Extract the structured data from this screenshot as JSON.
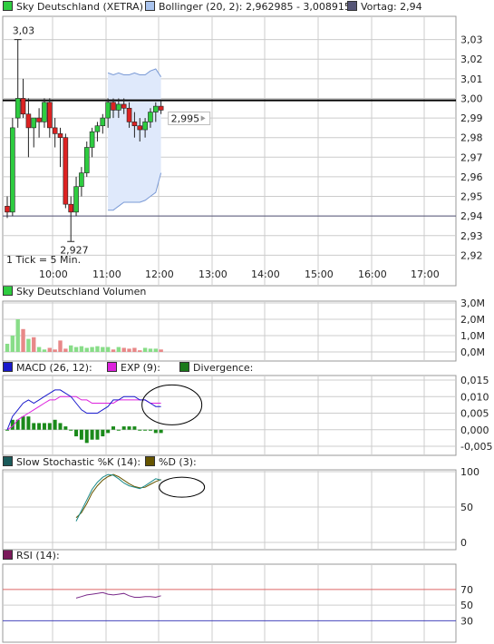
{
  "price_panel": {
    "legend": [
      {
        "label": "Sky Deutschland (XETRA)",
        "color": "#2ecc40"
      },
      {
        "label": "Bollinger (20, 2): 2,962985 - 3,008915",
        "color": "#aac4ee"
      },
      {
        "label": "Vortag: 2,94",
        "color": "#555577"
      }
    ],
    "high_label": "3,03",
    "low_label": "2,927",
    "last_label": "2,995",
    "tick_note": "1 Tick = 5 Min."
  },
  "volume_panel": {
    "legend": [
      {
        "label": "Sky Deutschland Volumen",
        "color": "#2ecc40"
      }
    ]
  },
  "macd_panel": {
    "legend": [
      {
        "label": "MACD (26, 12):",
        "color": "#1a1acc"
      },
      {
        "label": "EXP (9):",
        "color": "#dd22dd"
      },
      {
        "label": "Divergence:",
        "color": "#1a7a1a"
      }
    ]
  },
  "stoch_panel": {
    "legend": [
      {
        "label": "Slow Stochastic %K (14):",
        "color": "#1a5a5a"
      },
      {
        "label": "%D (3):",
        "color": "#665500"
      }
    ]
  },
  "rsi_panel": {
    "legend": [
      {
        "label": "RSI (14):",
        "color": "#7a1a5a"
      }
    ]
  },
  "chart_data": [
    {
      "type": "candlestick",
      "title": "Sky Deutschland (XETRA)",
      "x_ticks": [
        "10:00",
        "11:00",
        "12:00",
        "13:00",
        "14:00",
        "15:00",
        "16:00",
        "17:00"
      ],
      "y_ticks": [
        "3,03",
        "3,02",
        "3,01",
        "3,00",
        "2,99",
        "2,98",
        "2,97",
        "2,96",
        "2,95",
        "2,94",
        "2,93",
        "2,92"
      ],
      "ylim": [
        2.91,
        3.04
      ],
      "session_start": "09:00",
      "interval_minutes": 5,
      "previous_close": 2.94,
      "reference_line": 2.999,
      "candles": [
        {
          "o": 2.945,
          "h": 2.95,
          "l": 2.939,
          "c": 2.942
        },
        {
          "o": 2.942,
          "h": 2.99,
          "l": 2.94,
          "c": 2.985
        },
        {
          "o": 2.99,
          "h": 3.03,
          "l": 2.985,
          "c": 3.0
        },
        {
          "o": 3.0,
          "h": 3.01,
          "l": 2.99,
          "c": 2.992
        },
        {
          "o": 2.992,
          "h": 3.0,
          "l": 2.97,
          "c": 2.985
        },
        {
          "o": 2.985,
          "h": 2.99,
          "l": 2.975,
          "c": 2.99
        },
        {
          "o": 2.99,
          "h": 2.995,
          "l": 2.98,
          "c": 2.988
        },
        {
          "o": 2.988,
          "h": 3.0,
          "l": 2.985,
          "c": 2.998
        },
        {
          "o": 2.998,
          "h": 3.0,
          "l": 2.98,
          "c": 2.985
        },
        {
          "o": 2.985,
          "h": 2.99,
          "l": 2.975,
          "c": 2.982
        },
        {
          "o": 2.982,
          "h": 2.985,
          "l": 2.965,
          "c": 2.98
        },
        {
          "o": 2.98,
          "h": 2.982,
          "l": 2.944,
          "c": 2.946
        },
        {
          "o": 2.946,
          "h": 2.95,
          "l": 2.927,
          "c": 2.942
        },
        {
          "o": 2.942,
          "h": 2.96,
          "l": 2.94,
          "c": 2.955
        },
        {
          "o": 2.955,
          "h": 2.965,
          "l": 2.95,
          "c": 2.962
        },
        {
          "o": 2.962,
          "h": 2.978,
          "l": 2.96,
          "c": 2.975
        },
        {
          "o": 2.975,
          "h": 2.985,
          "l": 2.97,
          "c": 2.983
        },
        {
          "o": 2.983,
          "h": 2.988,
          "l": 2.978,
          "c": 2.986
        },
        {
          "o": 2.986,
          "h": 2.992,
          "l": 2.982,
          "c": 2.99
        },
        {
          "o": 2.99,
          "h": 3.0,
          "l": 2.985,
          "c": 2.998
        },
        {
          "o": 2.998,
          "h": 3.0,
          "l": 2.99,
          "c": 2.994
        },
        {
          "o": 2.994,
          "h": 3.0,
          "l": 2.99,
          "c": 2.997
        },
        {
          "o": 2.997,
          "h": 3.0,
          "l": 2.992,
          "c": 2.995
        },
        {
          "o": 2.995,
          "h": 2.998,
          "l": 2.985,
          "c": 2.988
        },
        {
          "o": 2.988,
          "h": 2.993,
          "l": 2.98,
          "c": 2.986
        },
        {
          "o": 2.986,
          "h": 2.99,
          "l": 2.978,
          "c": 2.984
        },
        {
          "o": 2.984,
          "h": 2.99,
          "l": 2.98,
          "c": 2.988
        },
        {
          "o": 2.988,
          "h": 2.995,
          "l": 2.985,
          "c": 2.993
        },
        {
          "o": 2.993,
          "h": 2.998,
          "l": 2.988,
          "c": 2.996
        },
        {
          "o": 2.996,
          "h": 2.999,
          "l": 2.992,
          "c": 2.994
        }
      ],
      "bollinger_start_index": 19,
      "bollinger_upper": [
        3.013,
        3.012,
        3.013,
        3.012,
        3.012,
        3.013,
        3.012,
        3.012,
        3.014,
        3.015,
        3.011
      ],
      "bollinger_lower": [
        2.943,
        2.943,
        2.945,
        2.947,
        2.947,
        2.947,
        2.947,
        2.948,
        2.95,
        2.952,
        2.962
      ]
    },
    {
      "type": "bar",
      "title": "Sky Deutschland Volumen",
      "y_ticks": [
        "3,0M",
        "2,0M",
        "1,0M",
        "0,0M"
      ],
      "ylim": [
        0,
        3000000
      ],
      "values": [
        500000,
        1000000,
        2000000,
        1400000,
        800000,
        900000,
        300000,
        150000,
        250000,
        150000,
        700000,
        200000,
        400000,
        300000,
        350000,
        250000,
        300000,
        350000,
        300000,
        300000,
        150000,
        300000,
        250000,
        200000,
        250000,
        100000,
        250000,
        200000,
        200000,
        150000
      ],
      "up": [
        true,
        true,
        true,
        false,
        true,
        false,
        true,
        true,
        false,
        false,
        false,
        false,
        true,
        true,
        true,
        true,
        true,
        true,
        true,
        true,
        false,
        true,
        false,
        false,
        false,
        false,
        true,
        true,
        true,
        false
      ]
    },
    {
      "type": "line",
      "title": "MACD",
      "y_ticks": [
        "0,015",
        "0,010",
        "0,005",
        "0,000",
        "-0,005"
      ],
      "ylim": [
        -0.005,
        0.015
      ],
      "series": [
        {
          "name": "MACD (26, 12):",
          "values": [
            0.0,
            0.004,
            0.006,
            0.008,
            0.009,
            0.008,
            0.009,
            0.01,
            0.011,
            0.012,
            0.012,
            0.011,
            0.01,
            0.008,
            0.006,
            0.005,
            0.005,
            0.005,
            0.006,
            0.007,
            0.009,
            0.009,
            0.01,
            0.01,
            0.01,
            0.009,
            0.009,
            0.008,
            0.007,
            0.007
          ]
        },
        {
          "name": "EXP (9):",
          "values": [
            0.0,
            0.001,
            0.003,
            0.004,
            0.005,
            0.006,
            0.007,
            0.008,
            0.009,
            0.009,
            0.01,
            0.01,
            0.01,
            0.01,
            0.009,
            0.009,
            0.008,
            0.008,
            0.008,
            0.008,
            0.008,
            0.009,
            0.009,
            0.009,
            0.009,
            0.009,
            0.009,
            0.008,
            0.008,
            0.008
          ]
        },
        {
          "name": "Divergence:",
          "values": [
            0.0,
            0.003,
            0.003,
            0.004,
            0.004,
            0.002,
            0.002,
            0.002,
            0.002,
            0.003,
            0.002,
            0.001,
            0.0,
            -0.002,
            -0.003,
            -0.004,
            -0.003,
            -0.003,
            -0.002,
            -0.001,
            0.001,
            0.0,
            0.001,
            0.001,
            0.001,
            0.0,
            0.0,
            0.0,
            -0.001,
            -0.001
          ]
        }
      ]
    },
    {
      "type": "line",
      "title": "Slow Stochastic",
      "y_ticks": [
        "100",
        "50",
        "0"
      ],
      "ylim": [
        0,
        100
      ],
      "start_index": 13,
      "series": [
        {
          "name": "Slow Stochastic %K (14):",
          "values": [
            30,
            45,
            60,
            75,
            85,
            92,
            96,
            95,
            90,
            84,
            80,
            78,
            76,
            80,
            85,
            90,
            88
          ]
        },
        {
          "name": "%D (3):",
          "values": [
            35,
            42,
            55,
            70,
            80,
            88,
            93,
            96,
            93,
            88,
            83,
            79,
            77,
            78,
            82,
            86,
            89
          ]
        }
      ]
    },
    {
      "type": "line",
      "title": "RSI",
      "y_ticks": [
        "70",
        "50",
        "30"
      ],
      "ylim": [
        5,
        100
      ],
      "reference_lines": [
        70,
        30
      ],
      "start_index": 13,
      "series": [
        {
          "name": "RSI (14):",
          "values": [
            59,
            61,
            63,
            64,
            65,
            66,
            64,
            63,
            64,
            65,
            62,
            60,
            60,
            61,
            61,
            60,
            62
          ]
        }
      ]
    }
  ]
}
